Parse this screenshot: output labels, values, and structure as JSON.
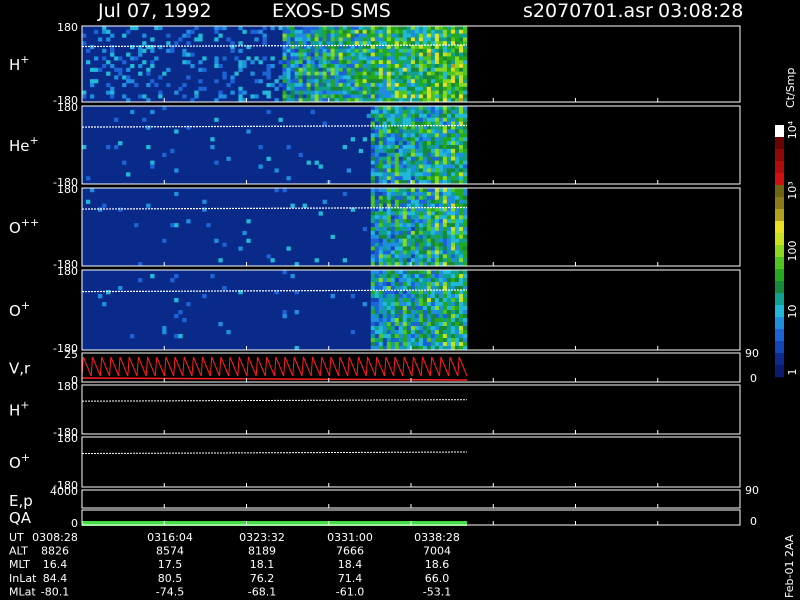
{
  "header": {
    "date": "Jul 07, 1992",
    "instrument": "EXOS-D SMS",
    "file": "s2070701.asr",
    "time": "03:08:28"
  },
  "colors": {
    "background": "#000000",
    "spectrogram_fill": "#0a2a8a",
    "velocity_trace": "#ff2020",
    "qa_bar": "#44dd44",
    "axis": "#ffffff"
  },
  "chart_data": {
    "type": "heatmap",
    "panels": [
      {
        "label": "H",
        "sup": "+",
        "ylim": [
          -180,
          180
        ],
        "tick_top": "180",
        "tick_bottom": "-180",
        "kind": "spectrogram",
        "seed": 11
      },
      {
        "label": "He",
        "sup": "+",
        "ylim": [
          -180,
          180
        ],
        "tick_top": "180",
        "tick_bottom": "-180",
        "kind": "spectrogram",
        "seed": 23
      },
      {
        "label": "O",
        "sup": "++",
        "ylim": [
          -180,
          180
        ],
        "tick_top": "180",
        "tick_bottom": "-180",
        "kind": "spectrogram",
        "seed": 37
      },
      {
        "label": "O",
        "sup": "+",
        "ylim": [
          -180,
          180
        ],
        "tick_top": "180",
        "tick_bottom": "-180",
        "kind": "spectrogram",
        "seed": 41
      },
      {
        "label": "V,r",
        "sup": "",
        "ylim": [
          0,
          25
        ],
        "tick_top": "25",
        "tick_bottom": "0",
        "right_top": "90",
        "right_bottom": "0",
        "kind": "velocity"
      },
      {
        "label": "H",
        "sup": "+",
        "ylim": [
          -180,
          180
        ],
        "tick_top": "180",
        "tick_bottom": "-180",
        "kind": "line"
      },
      {
        "label": "O",
        "sup": "+",
        "ylim": [
          -180,
          180
        ],
        "tick_top": "180",
        "tick_bottom": "-180",
        "kind": "line"
      },
      {
        "label": "E,p",
        "sup": "",
        "tick_top": "4000",
        "tick_bottom": "",
        "right_top": "90",
        "right_bottom": "",
        "kind": "energy"
      },
      {
        "label": "QA",
        "sup": "",
        "tick_top": "",
        "tick_bottom": "0",
        "right_top": "",
        "right_bottom": "0",
        "kind": "qa"
      }
    ],
    "colorbar": {
      "unit": "Ct/Smp",
      "labels": [
        "1",
        "10",
        "100",
        "10³",
        "10⁴"
      ],
      "colors": [
        "#0b1a6e",
        "#0e2a8c",
        "#1546b8",
        "#1c63d6",
        "#1f8ee0",
        "#22b8d8",
        "#10a090",
        "#168a3a",
        "#23a81e",
        "#4ec420",
        "#8ad820",
        "#c8e020",
        "#e8e020",
        "#b0a020",
        "#8a7a18",
        "#6e6414",
        "#d01010",
        "#b00c0c",
        "#900808",
        "#6a0404",
        "#ffffff"
      ]
    },
    "time_axis": {
      "rows": [
        {
          "label": "UT",
          "values": [
            "0308:28",
            "0316:04",
            "0323:32",
            "0331:00",
            "0338:28"
          ]
        },
        {
          "label": "ALT",
          "values": [
            "8826",
            "8574",
            "8189",
            "7666",
            "7004"
          ]
        },
        {
          "label": "MLT",
          "values": [
            "16.4",
            "17.5",
            "18.1",
            "18.4",
            "18.6"
          ]
        },
        {
          "label": "InLat",
          "values": [
            "84.4",
            "80.5",
            "76.2",
            "71.4",
            "66.0"
          ]
        },
        {
          "label": "MLat",
          "values": [
            "-80.1",
            "-74.5",
            "-68.1",
            "-61.0",
            "-53.1"
          ]
        }
      ]
    },
    "footer_vertical": "Feb-01 2AA"
  }
}
